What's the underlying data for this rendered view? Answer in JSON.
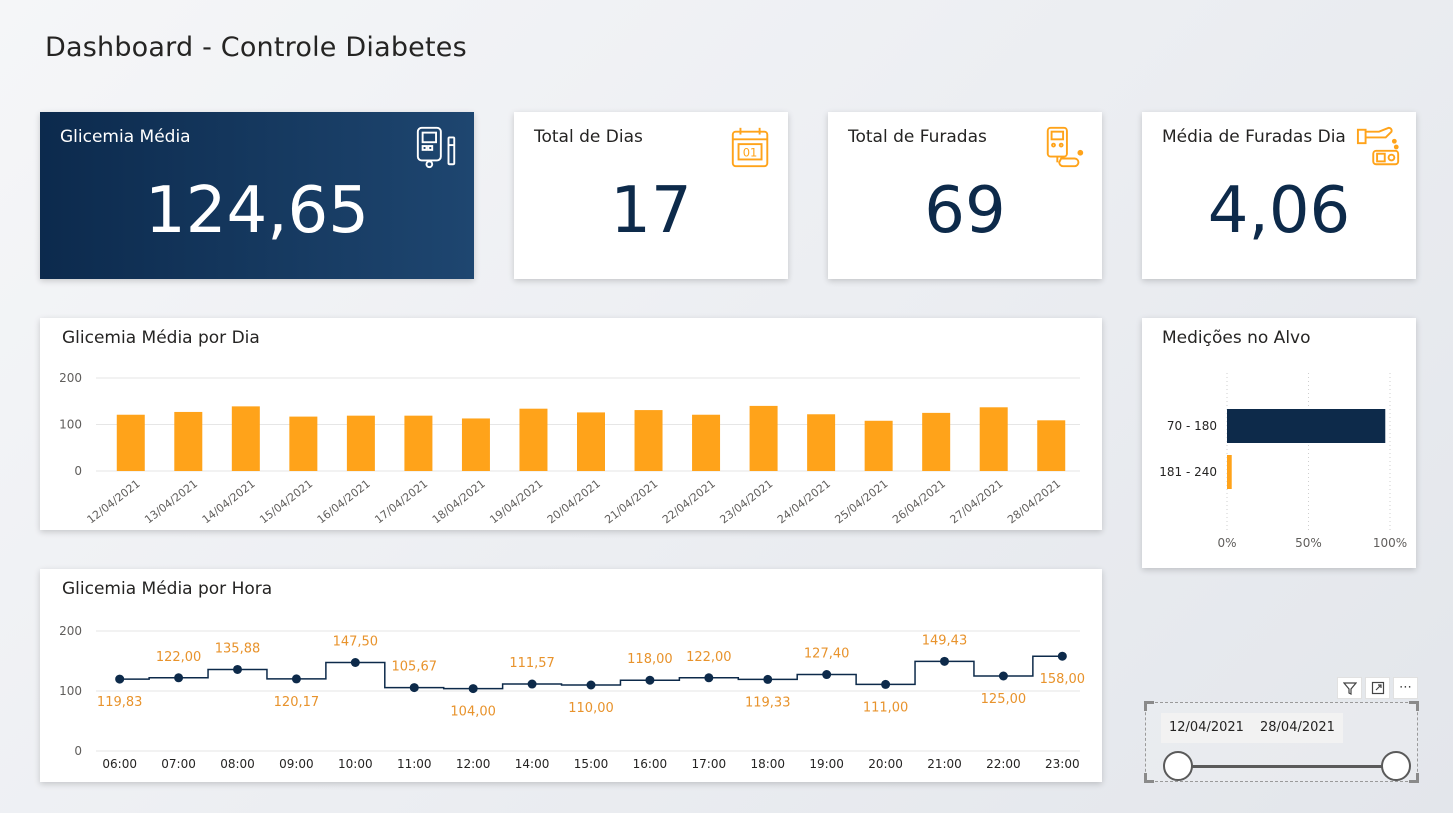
{
  "page": {
    "title": "Dashboard - Controle Diabetes"
  },
  "kpis": [
    {
      "title": "Glicemia Média",
      "value": "124,65",
      "icon": "glucose-meter-icon"
    },
    {
      "title": "Total de Dias",
      "value": "17",
      "icon": "calendar-icon"
    },
    {
      "title": "Total de Furadas",
      "value": "69",
      "icon": "finger-prick-icon"
    },
    {
      "title": "Média de Furadas Dia",
      "value": "4,06",
      "icon": "lancet-hand-icon"
    }
  ],
  "colors": {
    "accent": "#FFA31A",
    "navy": "#0D2A4A",
    "text": "#252423"
  },
  "slicer": {
    "start": "12/04/2021",
    "end": "28/04/2021"
  },
  "chart_data": [
    {
      "type": "bar",
      "title": "Glicemia Média por Dia",
      "categories": [
        "12/04/2021",
        "13/04/2021",
        "14/04/2021",
        "15/04/2021",
        "16/04/2021",
        "17/04/2021",
        "18/04/2021",
        "19/04/2021",
        "20/04/2021",
        "21/04/2021",
        "22/04/2021",
        "23/04/2021",
        "24/04/2021",
        "25/04/2021",
        "26/04/2021",
        "27/04/2021",
        "28/04/2021"
      ],
      "values": [
        121,
        127,
        139,
        117,
        119,
        119,
        113,
        134,
        126,
        131,
        121,
        140,
        122,
        108,
        125,
        137,
        109
      ],
      "ylim": [
        0,
        200
      ],
      "yticks": [
        "0",
        "100",
        "200"
      ],
      "color": "#FFA31A",
      "grid": true
    },
    {
      "type": "line",
      "title": "Glicemia Média por Hora",
      "categories": [
        "06:00",
        "07:00",
        "08:00",
        "09:00",
        "10:00",
        "11:00",
        "12:00",
        "14:00",
        "15:00",
        "16:00",
        "17:00",
        "18:00",
        "19:00",
        "20:00",
        "21:00",
        "22:00",
        "23:00"
      ],
      "values": [
        119.83,
        122.0,
        135.88,
        120.17,
        147.5,
        105.67,
        104.0,
        111.57,
        110.0,
        118.0,
        122.0,
        119.33,
        127.4,
        111.0,
        149.43,
        125.0,
        158.0
      ],
      "labels": [
        "119,83",
        "122,00",
        "135,88",
        "120,17",
        "147,50",
        "105,67",
        "104,00",
        "111,57",
        "110,00",
        "118,00",
        "122,00",
        "119,33",
        "127,40",
        "111,00",
        "149,43",
        "125,00",
        "158,00"
      ],
      "label_position": [
        "below",
        "above",
        "above",
        "below",
        "above",
        "above",
        "below",
        "above",
        "below",
        "above",
        "above",
        "below",
        "above",
        "below",
        "above",
        "below",
        "below"
      ],
      "ylim": [
        0,
        200
      ],
      "yticks": [
        "0",
        "100",
        "200"
      ],
      "line_style": "step",
      "line_color": "#0D2A4A",
      "label_color": "#E8932C",
      "grid": true
    },
    {
      "type": "bar",
      "orientation": "horizontal",
      "title": "Medições no Alvo",
      "categories": [
        "70 - 180",
        "181 - 240"
      ],
      "values": [
        97.1,
        2.9
      ],
      "colors": [
        "#0D2A4A",
        "#FFA31A"
      ],
      "xlim": [
        0,
        100
      ],
      "xticks": [
        "0%",
        "50%",
        "100%"
      ],
      "grid": true
    }
  ]
}
